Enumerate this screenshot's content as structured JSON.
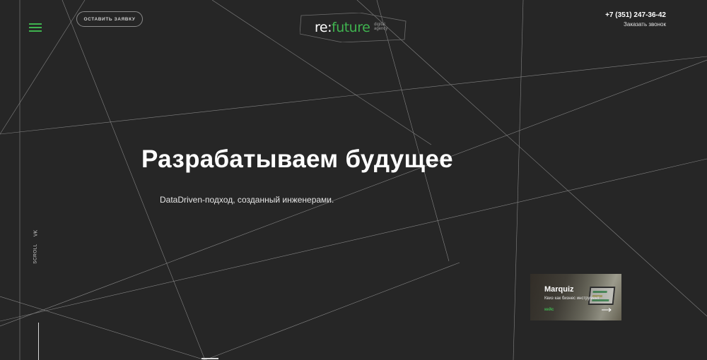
{
  "header": {
    "cta_label": "Оставить заявку",
    "logo": {
      "main_re": "re:",
      "main_future": "future",
      "sub_line1": "digital",
      "sub_line2": "agency"
    },
    "phone": "+7 (351) 247-36-42",
    "callback_label": "Заказать звонок"
  },
  "hero": {
    "title": "Разрабатываем будущее",
    "subtitle": "DataDriven-подход, созданный инженерами."
  },
  "side": {
    "social_vk": "VK",
    "scroll_label": "SCROLL"
  },
  "card": {
    "title": "Marquiz",
    "subtitle": "Квиз как бизнес инструмент",
    "tag": "кейс"
  },
  "colors": {
    "background": "#262626",
    "accent": "#3fb34f",
    "text": "#ffffff",
    "lines": "#9a9a9a"
  },
  "icons": {
    "menu": "hamburger-icon",
    "arrow": "arrow-right-icon"
  }
}
